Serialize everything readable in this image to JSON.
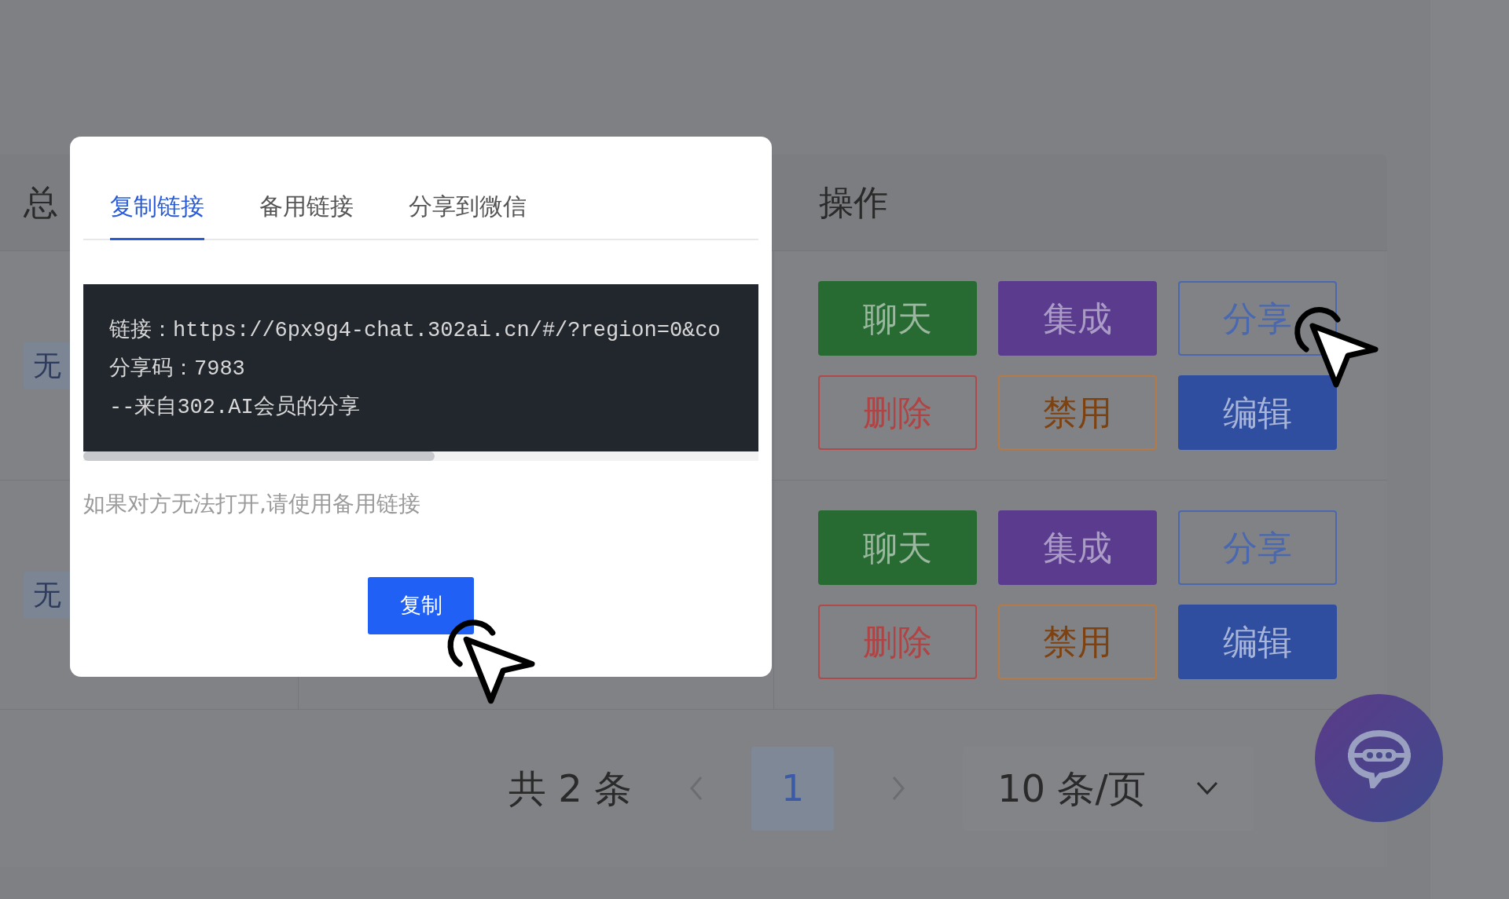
{
  "table": {
    "columns": [
      {
        "label": "总"
      },
      {
        "label": "操作"
      }
    ],
    "rows": [
      {
        "tag": "无",
        "actions": [
          {
            "label": "聊天",
            "kind": "chat"
          },
          {
            "label": "集成",
            "kind": "integrate"
          },
          {
            "label": "分享",
            "kind": "share"
          },
          {
            "label": "删除",
            "kind": "delete"
          },
          {
            "label": "禁用",
            "kind": "disable"
          },
          {
            "label": "编辑",
            "kind": "edit"
          }
        ]
      },
      {
        "tag": "无",
        "actions": [
          {
            "label": "聊天",
            "kind": "chat"
          },
          {
            "label": "集成",
            "kind": "integrate"
          },
          {
            "label": "分享",
            "kind": "share"
          },
          {
            "label": "删除",
            "kind": "delete"
          },
          {
            "label": "禁用",
            "kind": "disable"
          },
          {
            "label": "编辑",
            "kind": "edit"
          }
        ]
      }
    ]
  },
  "pagination": {
    "total": "共 2 条",
    "pages": [
      {
        "label": "1",
        "selected": true
      }
    ],
    "page_size": "10 条/页"
  },
  "modal": {
    "tabs": [
      {
        "label": "复制链接",
        "selected": true
      },
      {
        "label": "备用链接",
        "selected": false
      },
      {
        "label": "分享到微信",
        "selected": false
      }
    ],
    "code_lines": [
      "链接：https://6px9g4-chat.302ai.cn/#/?region=0&co",
      "分享码：7983",
      "--来自302.AI会员的分享"
    ],
    "hint": "如果对方无法打开,请使用备用链接",
    "copy_button": "复制"
  }
}
